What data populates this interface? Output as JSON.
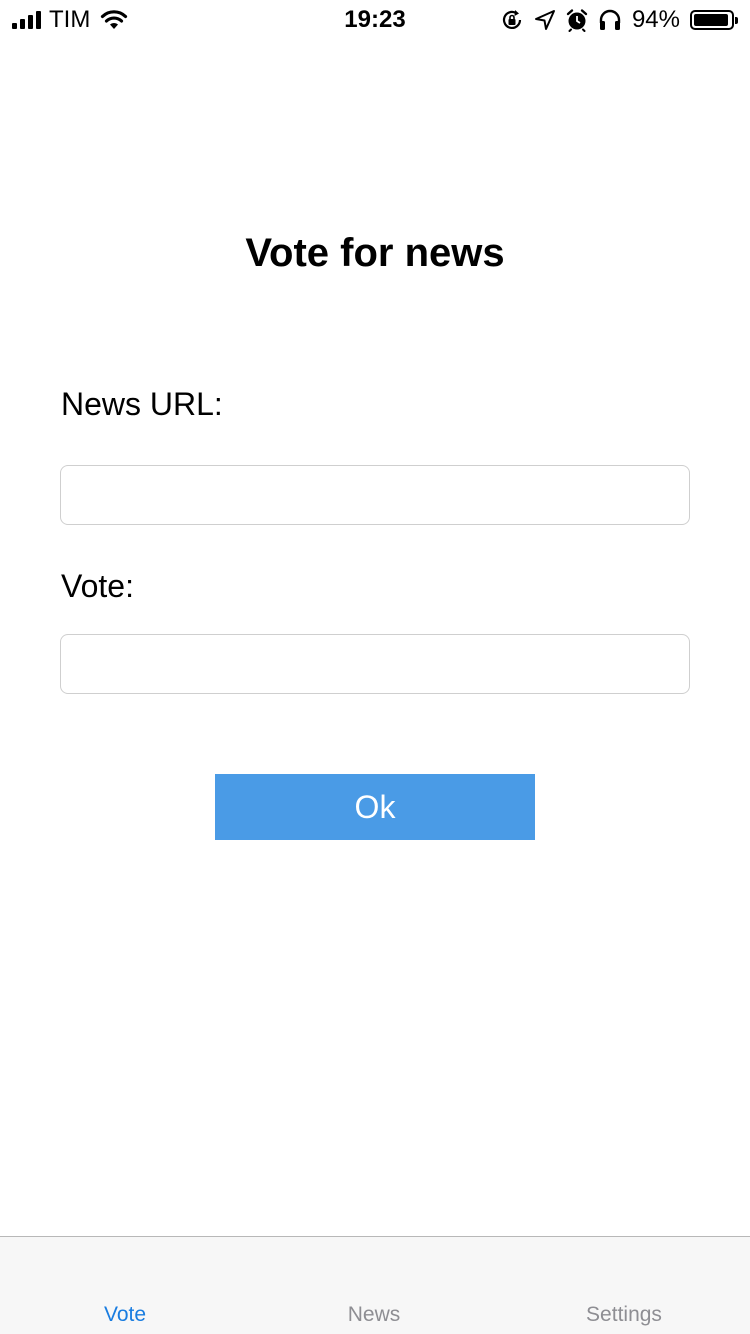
{
  "status_bar": {
    "carrier": "TIM",
    "time": "19:23",
    "battery_percent": "94%",
    "battery_level": 0.94,
    "icons": [
      "signal-icon",
      "wifi-icon",
      "rotation-lock-icon",
      "location-icon",
      "alarm-icon",
      "headphones-icon",
      "battery-icon"
    ]
  },
  "main": {
    "title": "Vote for news",
    "url_label": "News URL:",
    "url_value": "",
    "vote_label": "Vote:",
    "vote_value": "",
    "ok_label": "Ok"
  },
  "tab_bar": {
    "active": "Vote",
    "tabs": [
      {
        "label": "Vote"
      },
      {
        "label": "News"
      },
      {
        "label": "Settings"
      }
    ]
  },
  "colors": {
    "accent": "#1a7de0",
    "button": "#4a9be6",
    "tab_inactive": "#8e8e93",
    "tab_bar_bg": "#f7f7f7"
  }
}
